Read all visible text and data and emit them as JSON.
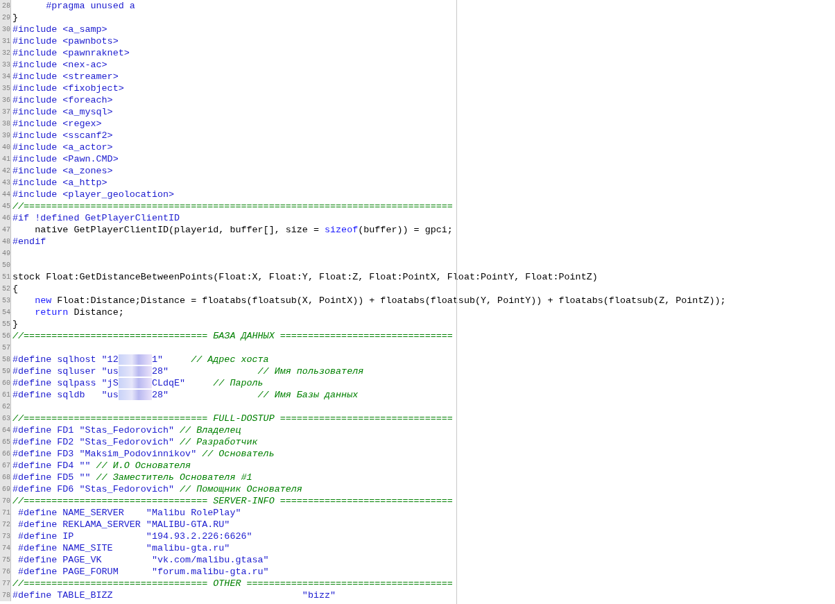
{
  "editor": {
    "lines": [
      {
        "number": "28",
        "tokens": [
          {
            "kind": "pre",
            "text": "      #pragma unused a"
          }
        ]
      },
      {
        "number": "29",
        "tokens": [
          {
            "kind": "plain",
            "text": "}"
          }
        ]
      },
      {
        "number": "30",
        "tokens": [
          {
            "kind": "pre",
            "text": "#include <a_samp>"
          }
        ]
      },
      {
        "number": "31",
        "tokens": [
          {
            "kind": "pre",
            "text": "#include <pawnbots>"
          }
        ]
      },
      {
        "number": "32",
        "tokens": [
          {
            "kind": "pre",
            "text": "#include <pawnraknet>"
          }
        ]
      },
      {
        "number": "33",
        "tokens": [
          {
            "kind": "pre",
            "text": "#include <nex-ac>"
          }
        ]
      },
      {
        "number": "34",
        "tokens": [
          {
            "kind": "pre",
            "text": "#include <streamer>"
          }
        ]
      },
      {
        "number": "35",
        "tokens": [
          {
            "kind": "pre",
            "text": "#include <fixobject>"
          }
        ]
      },
      {
        "number": "36",
        "tokens": [
          {
            "kind": "pre",
            "text": "#include <foreach>"
          }
        ]
      },
      {
        "number": "37",
        "tokens": [
          {
            "kind": "pre",
            "text": "#include <a_mysql>"
          }
        ]
      },
      {
        "number": "38",
        "tokens": [
          {
            "kind": "pre",
            "text": "#include <regex>"
          }
        ]
      },
      {
        "number": "39",
        "tokens": [
          {
            "kind": "pre",
            "text": "#include <sscanf2>"
          }
        ]
      },
      {
        "number": "40",
        "tokens": [
          {
            "kind": "pre",
            "text": "#include <a_actor>"
          }
        ]
      },
      {
        "number": "41",
        "tokens": [
          {
            "kind": "pre",
            "text": "#include <Pawn.CMD>"
          }
        ]
      },
      {
        "number": "42",
        "tokens": [
          {
            "kind": "pre",
            "text": "#include <a_zones>"
          }
        ]
      },
      {
        "number": "43",
        "tokens": [
          {
            "kind": "pre",
            "text": "#include <a_http>"
          }
        ]
      },
      {
        "number": "44",
        "tokens": [
          {
            "kind": "pre",
            "text": "#include <player_geolocation>"
          }
        ]
      },
      {
        "number": "45",
        "tokens": [
          {
            "kind": "comment",
            "text": "//============================================================================="
          }
        ]
      },
      {
        "number": "46",
        "tokens": [
          {
            "kind": "pre",
            "text": "#if !defined GetPlayerClientID"
          }
        ]
      },
      {
        "number": "47",
        "tokens": [
          {
            "kind": "plain",
            "text": "    native GetPlayerClientID(playerid, buffer[], size = "
          },
          {
            "kind": "keyword",
            "text": "sizeof"
          },
          {
            "kind": "plain",
            "text": "(buffer)) = gpci;"
          }
        ]
      },
      {
        "number": "48",
        "tokens": [
          {
            "kind": "pre",
            "text": "#endif"
          }
        ]
      },
      {
        "number": "49"
      },
      {
        "number": "50"
      },
      {
        "number": "51",
        "tokens": [
          {
            "kind": "plain",
            "text": "stock Float:GetDistanceBetweenPoints(Float:X, Float:Y, Float:Z, Float:PointX, Float:PointY, Float:PointZ)"
          }
        ]
      },
      {
        "number": "52",
        "tokens": [
          {
            "kind": "plain",
            "text": "{"
          }
        ]
      },
      {
        "number": "53",
        "tokens": [
          {
            "kind": "keyword",
            "text": "    new"
          },
          {
            "kind": "plain",
            "text": " Float:Distance;Distance = floatabs(floatsub(X, PointX)) + floatabs(floatsub(Y, PointY)) + floatabs(floatsub(Z, PointZ));"
          }
        ]
      },
      {
        "number": "54",
        "tokens": [
          {
            "kind": "keyword",
            "text": "    return"
          },
          {
            "kind": "plain",
            "text": " Distance;"
          }
        ]
      },
      {
        "number": "55",
        "tokens": [
          {
            "kind": "plain",
            "text": "}"
          }
        ]
      },
      {
        "number": "56",
        "tokens": [
          {
            "kind": "comment",
            "text": "//================================= БАЗА ДАННЫХ ==============================="
          }
        ]
      },
      {
        "number": "57"
      },
      {
        "number": "58",
        "tokens": [
          {
            "kind": "pre",
            "text": "#define sqlhost \"12"
          },
          {
            "kind": "redacted"
          },
          {
            "kind": "pre",
            "text": "1\"     "
          },
          {
            "kind": "comment",
            "text": "// Адрес хоста"
          }
        ]
      },
      {
        "number": "59",
        "tokens": [
          {
            "kind": "pre",
            "text": "#define sqluser \"us"
          },
          {
            "kind": "redacted"
          },
          {
            "kind": "pre",
            "text": "28\"                "
          },
          {
            "kind": "comment",
            "text": "// Имя пользователя"
          }
        ]
      },
      {
        "number": "60",
        "tokens": [
          {
            "kind": "pre",
            "text": "#define sqlpass \"jS"
          },
          {
            "kind": "redacted"
          },
          {
            "kind": "pre",
            "text": "CLdqE\"     "
          },
          {
            "kind": "comment",
            "text": "// Пароль"
          }
        ]
      },
      {
        "number": "61",
        "tokens": [
          {
            "kind": "pre",
            "text": "#define sqldb   \"us"
          },
          {
            "kind": "redacted"
          },
          {
            "kind": "pre",
            "text": "28\"                "
          },
          {
            "kind": "comment",
            "text": "// Имя Базы данных"
          }
        ]
      },
      {
        "number": "62"
      },
      {
        "number": "63",
        "tokens": [
          {
            "kind": "comment",
            "text": "//================================= FULL-DOSTUP ==============================="
          }
        ]
      },
      {
        "number": "64",
        "tokens": [
          {
            "kind": "pre",
            "text": "#define FD1 \"Stas_Fedorovich\" "
          },
          {
            "kind": "comment",
            "text": "// Владелец"
          }
        ]
      },
      {
        "number": "65",
        "tokens": [
          {
            "kind": "pre",
            "text": "#define FD2 \"Stas_Fedorovich\" "
          },
          {
            "kind": "comment",
            "text": "// Разработчик"
          }
        ]
      },
      {
        "number": "66",
        "tokens": [
          {
            "kind": "pre",
            "text": "#define FD3 \"Maksim_Podovinnikov\" "
          },
          {
            "kind": "comment",
            "text": "// Основатель"
          }
        ]
      },
      {
        "number": "67",
        "tokens": [
          {
            "kind": "pre",
            "text": "#define FD4 \"\" "
          },
          {
            "kind": "comment",
            "text": "// И.О Основателя"
          }
        ]
      },
      {
        "number": "68",
        "tokens": [
          {
            "kind": "pre",
            "text": "#define FD5 \"\" "
          },
          {
            "kind": "comment",
            "text": "// Заместитель Основателя #1"
          }
        ]
      },
      {
        "number": "69",
        "tokens": [
          {
            "kind": "pre",
            "text": "#define FD6 \"Stas_Fedorovich\" "
          },
          {
            "kind": "comment",
            "text": "// Помощник Основателя"
          }
        ]
      },
      {
        "number": "70",
        "tokens": [
          {
            "kind": "comment",
            "text": "//================================= SERVER-INFO ==============================="
          }
        ]
      },
      {
        "number": "71",
        "tokens": [
          {
            "kind": "pre",
            "text": " #define NAME_SERVER    \"Malibu RolePlay\""
          }
        ]
      },
      {
        "number": "72",
        "tokens": [
          {
            "kind": "pre",
            "text": " #define REKLAMA_SERVER \"MALIBU-GTA.RU\""
          }
        ]
      },
      {
        "number": "73",
        "tokens": [
          {
            "kind": "pre",
            "text": " #define IP             \"194.93.2.226:6626\""
          }
        ]
      },
      {
        "number": "74",
        "tokens": [
          {
            "kind": "pre",
            "text": " #define NAME_SITE      \"malibu-gta.ru\""
          }
        ]
      },
      {
        "number": "75",
        "tokens": [
          {
            "kind": "pre",
            "text": " #define PAGE_VK         \"vk.com/malibu.gtasa\""
          }
        ]
      },
      {
        "number": "76",
        "tokens": [
          {
            "kind": "pre",
            "text": " #define PAGE_FORUM      \"forum.malibu-gta.ru\""
          }
        ]
      },
      {
        "number": "77",
        "tokens": [
          {
            "kind": "comment",
            "text": "//================================= OTHER ====================================="
          }
        ]
      },
      {
        "number": "78",
        "tokens": [
          {
            "kind": "pre",
            "text": "#define TABLE_BIZZ                                  \"bizz\""
          }
        ]
      }
    ]
  }
}
